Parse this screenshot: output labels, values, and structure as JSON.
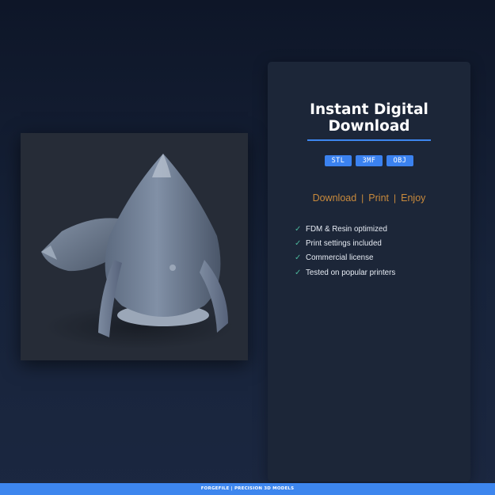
{
  "product": {
    "image_alt_icon": "rocket-model-icon"
  },
  "card": {
    "title_line1": "Instant Digital",
    "title_line2": "Download",
    "formats": [
      "STL",
      "3MF",
      "OBJ"
    ],
    "tagline": [
      "Download",
      "Print",
      "Enjoy"
    ],
    "tagline_separator": "|",
    "features": [
      "FDM & Resin optimized",
      "Print settings included",
      "Commercial license",
      "Tested on popular printers"
    ],
    "check_glyph": "✓"
  },
  "footer": {
    "text": "FORGEFILE | PRECISION 3D MODELS"
  },
  "colors": {
    "accent": "#3d86ee",
    "tagline": "#c98a3c",
    "check": "#4bb59a"
  }
}
